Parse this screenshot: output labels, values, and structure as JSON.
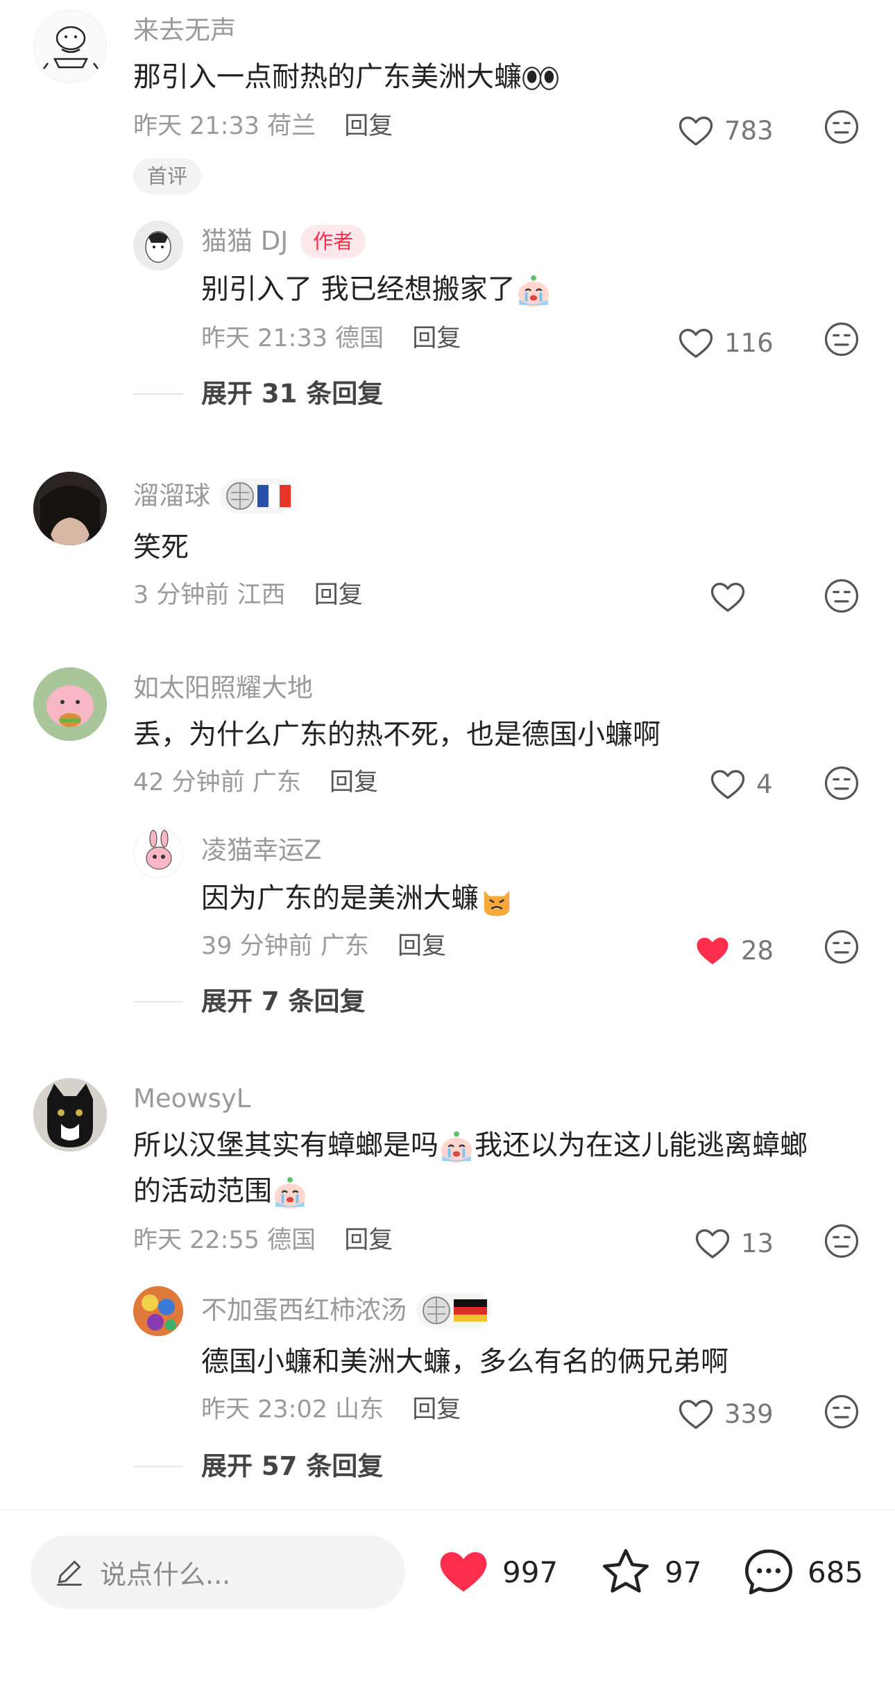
{
  "colors": {
    "accent": "#ff2e4d",
    "muted": "#9a9a9a",
    "text": "#222222"
  },
  "comments": [
    {
      "username": "来去无声",
      "text": "那引入一点耐热的广东美洲大蠊",
      "time": "昨天 21:33",
      "location": "荷兰",
      "reply_label": "回复",
      "likes": "783",
      "tag": "首评",
      "replies": [
        {
          "username": "猫猫 DJ",
          "badge": "作者",
          "text": "别引入了 我已经想搬家了",
          "time": "昨天 21:33",
          "location": "德国",
          "reply_label": "回复",
          "likes": "116"
        }
      ],
      "expand_label": "展开 31 条回复"
    },
    {
      "username": "溜溜球",
      "text": "笑死",
      "time": "3 分钟前",
      "location": "江西",
      "reply_label": "回复",
      "likes": ""
    },
    {
      "username": "如太阳照耀大地",
      "text": "丢，为什么广东的热不死，也是德国小蠊啊",
      "time": "42 分钟前",
      "location": "广东",
      "reply_label": "回复",
      "likes": "4",
      "replies": [
        {
          "username": "凌猫幸运Z",
          "text": "因为广东的是美洲大蠊",
          "time": "39 分钟前",
          "location": "广东",
          "reply_label": "回复",
          "likes": "28",
          "liked": true
        }
      ],
      "expand_label": "展开 7 条回复"
    },
    {
      "username": "MeowsyL",
      "text_line1": "所以汉堡其实有蟑螂是吗",
      "text_line1b": "我还以为在这儿能逃离蟑螂",
      "text_line2": "的活动范围",
      "time": "昨天 22:55",
      "location": "德国",
      "reply_label": "回复",
      "likes": "13",
      "replies": [
        {
          "username": "不加蛋西红柿浓汤",
          "text": "德国小蠊和美洲大蠊，多么有名的俩兄弟啊",
          "time": "昨天 23:02",
          "location": "山东",
          "reply_label": "回复",
          "likes": "339"
        }
      ],
      "expand_label": "展开 57 条回复"
    }
  ],
  "bottom_bar": {
    "input_placeholder": "说点什么...",
    "like_count": "997",
    "collect_count": "97",
    "comment_count": "685"
  }
}
